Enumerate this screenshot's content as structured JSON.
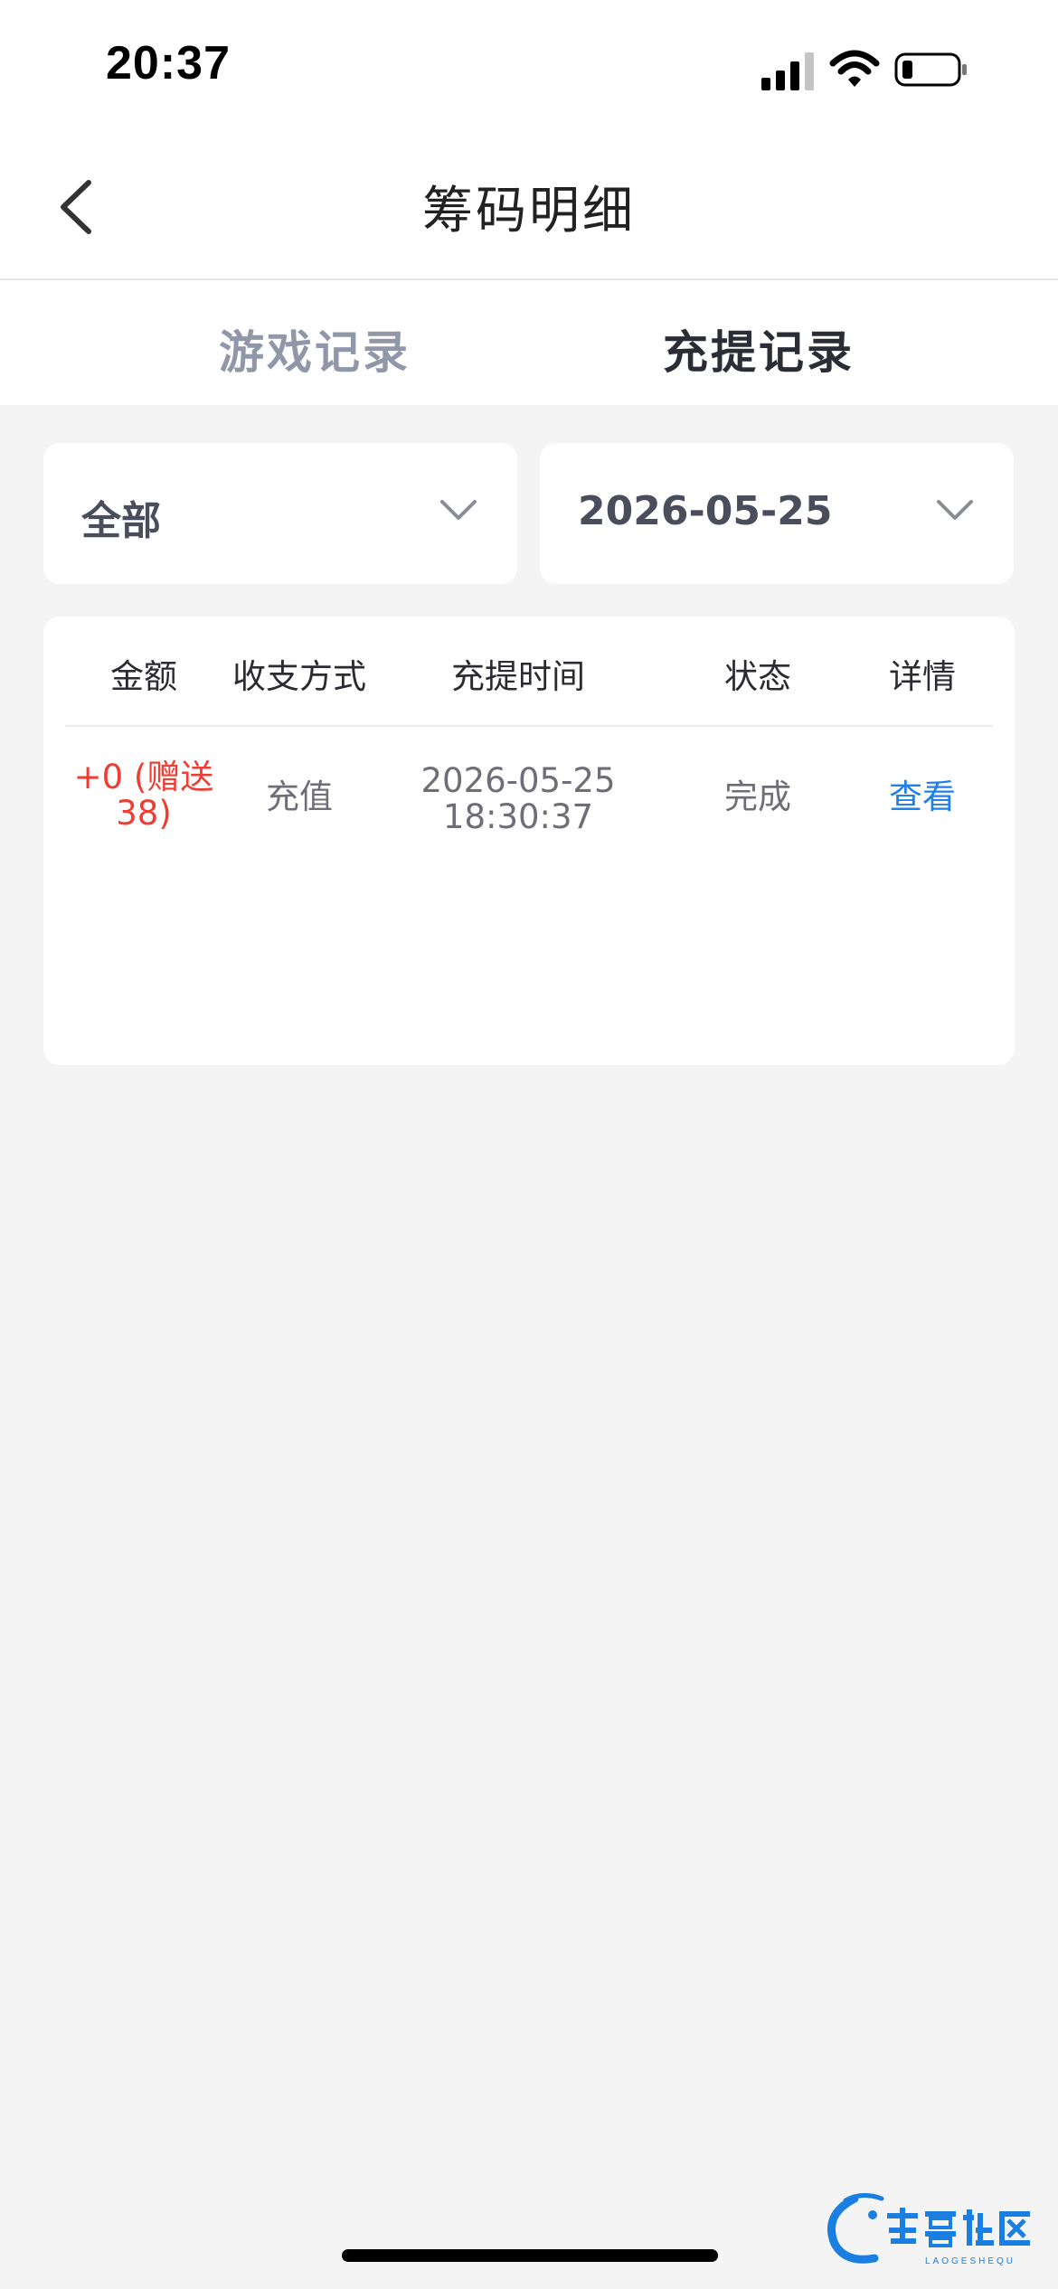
{
  "status_bar": {
    "time": "20:37"
  },
  "navbar": {
    "title": "筹码明细"
  },
  "tabs": [
    {
      "label": "游戏记录",
      "active": false
    },
    {
      "label": "充提记录",
      "active": true
    }
  ],
  "filters": {
    "type": {
      "selected": "全部"
    },
    "date": {
      "selected": "2026-05-25"
    }
  },
  "table": {
    "headers": [
      "金额",
      "收支方式",
      "充提时间",
      "状态",
      "详情"
    ],
    "rows": [
      {
        "amount_line1": "+0 (赠送",
        "amount_line2": "38)",
        "method": "充值",
        "time_date": "2026-05-25",
        "time_clock": "18:30:37",
        "status": "完成",
        "detail": "查看"
      }
    ]
  },
  "watermark": {
    "text": "老哥社区",
    "subtext": "LAOGESHEQU"
  },
  "colors": {
    "amount": "#ee3d33",
    "link": "#1f82e8",
    "tab_active": "#2a2d36",
    "tab_inactive": "#8f97a8",
    "background": "#f4f4f5"
  }
}
